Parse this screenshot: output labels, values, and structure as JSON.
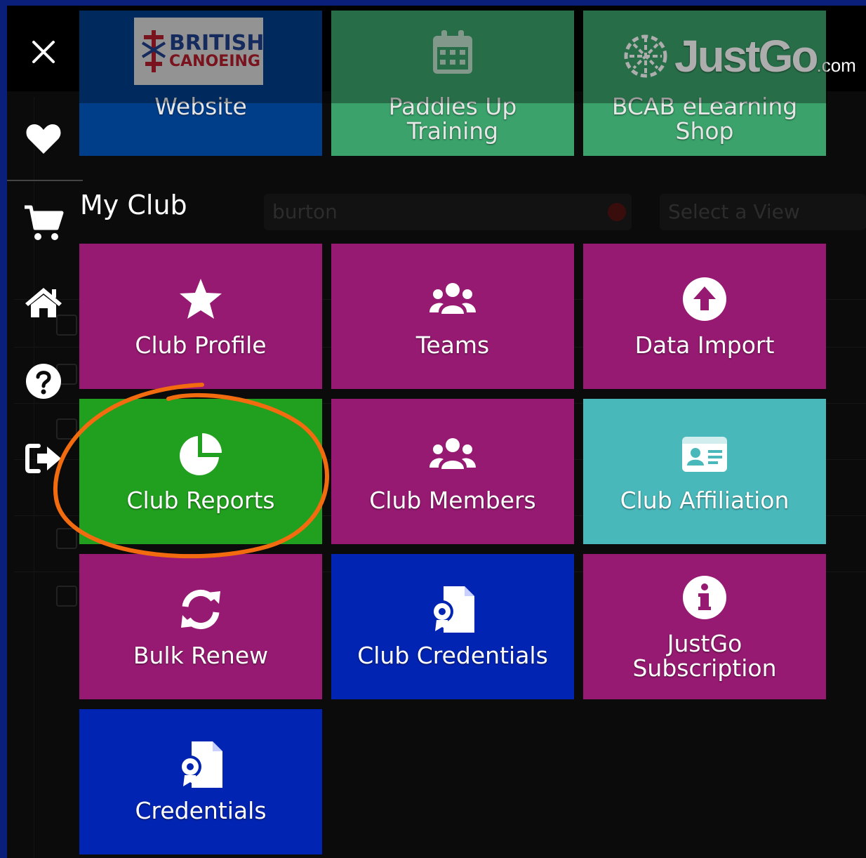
{
  "background": {
    "search_value": "burton",
    "view_placeholder": "Select a View"
  },
  "nav": {
    "items": [
      {
        "name": "favorites",
        "icon": "heart-icon"
      },
      {
        "name": "cart",
        "icon": "cart-icon"
      },
      {
        "name": "home",
        "icon": "home-icon"
      },
      {
        "name": "help",
        "icon": "question-circle-icon"
      },
      {
        "name": "logout",
        "icon": "sign-out-icon"
      }
    ],
    "close_icon": "close-icon"
  },
  "top_tiles": [
    {
      "label": "Website",
      "color": "#003e8a",
      "logo_line1": "BRITISH",
      "logo_line2": "CANOEING"
    },
    {
      "label": "Paddles Up Training",
      "color": "#3aa26a",
      "icon": "calendar-icon"
    },
    {
      "label": "BCAB eLearning Shop",
      "color": "#3aa26a",
      "logo": "JustGo",
      "logo_suffix": ".com"
    }
  ],
  "section": {
    "title": "My Club"
  },
  "tiles": [
    {
      "label": "Club Profile",
      "icon": "star-icon",
      "color": "#961a71"
    },
    {
      "label": "Teams",
      "icon": "users-icon",
      "color": "#961a71"
    },
    {
      "label": "Data Import",
      "icon": "upload-circle-icon",
      "color": "#961a71"
    },
    {
      "label": "Club Reports",
      "icon": "pie-chart-icon",
      "color": "#21a01f",
      "highlighted": true
    },
    {
      "label": "Club Members",
      "icon": "users-icon",
      "color": "#961a71"
    },
    {
      "label": "Club Affiliation",
      "icon": "id-card-icon",
      "color": "#48b8ba"
    },
    {
      "label": "Bulk Renew",
      "icon": "sync-icon",
      "color": "#961a71"
    },
    {
      "label": "Club Credentials",
      "icon": "certificate-file-icon",
      "color": "#0224b2"
    },
    {
      "label": "JustGo Subscription",
      "icon": "info-circle-icon",
      "color": "#961a71"
    },
    {
      "label": "Credentials",
      "icon": "certificate-file-icon",
      "color": "#0224b2"
    }
  ],
  "annotation": {
    "color": "#f26b0f",
    "target": "Club Reports"
  }
}
